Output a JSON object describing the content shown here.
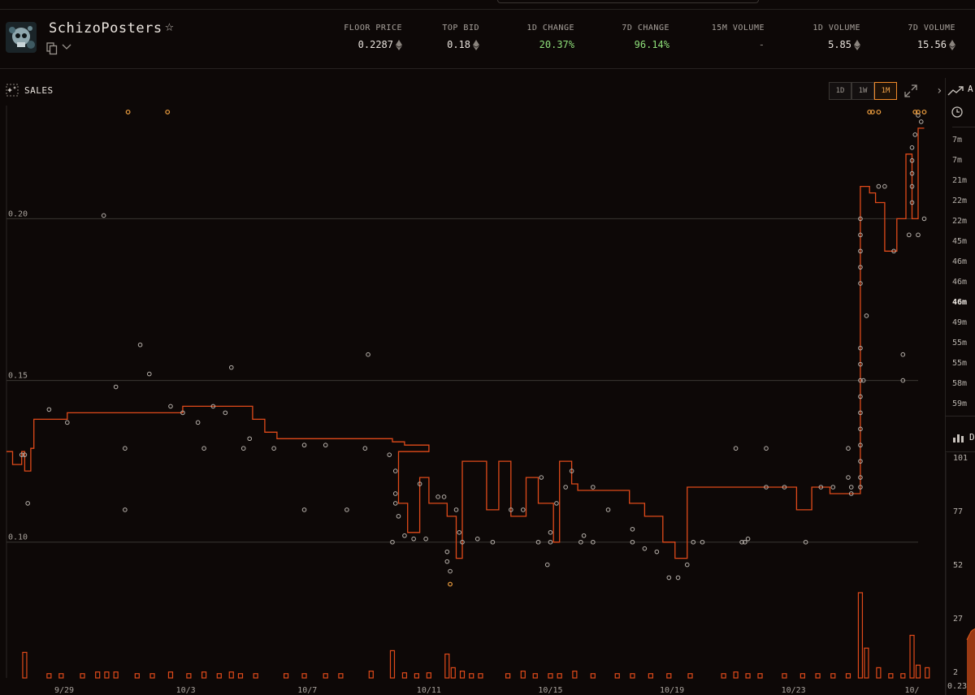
{
  "collection": {
    "name": "SchizoPosters",
    "icons": {
      "favorite": "star-outline-icon",
      "copy": "copy-icon",
      "menu": "chevron-down-icon"
    }
  },
  "stats": [
    {
      "label": "FLOOR PRICE",
      "value": "0.2287",
      "eth": true,
      "tone": "default"
    },
    {
      "label": "TOP BID",
      "value": "0.18",
      "eth": true,
      "tone": "default"
    },
    {
      "label": "1D CHANGE",
      "value": "20.37%",
      "eth": false,
      "tone": "positive"
    },
    {
      "label": "7D CHANGE",
      "value": "96.14%",
      "eth": false,
      "tone": "positive"
    },
    {
      "label": "15M VOLUME",
      "value": "-",
      "eth": false,
      "tone": "muted"
    },
    {
      "label": "1D VOLUME",
      "value": "5.85",
      "eth": true,
      "tone": "default"
    },
    {
      "label": "7D VOLUME",
      "value": "15.56",
      "eth": true,
      "tone": "default"
    }
  ],
  "panel": {
    "title": "SALES",
    "ranges": [
      "1D",
      "1W",
      "1M"
    ],
    "active_range": "1M",
    "icons": {
      "sales": "sparkles-icon",
      "expand": "expand-icon",
      "collapse": "chevron-right-icon"
    }
  },
  "colors": {
    "background": "#0d0807",
    "accent": "#f08a2a",
    "floor_line": "#e04a1a",
    "sale_dot": "#b8b2ac",
    "sale_dot_high": "#f0a040",
    "volume_bar": "#e04a1a",
    "positive": "#8fe07a"
  },
  "chart_data": {
    "type": "scatter",
    "title": "SALES",
    "xlabel": "",
    "ylabel": "",
    "x_ticks": [
      "9/29",
      "10/3",
      "10/7",
      "10/11",
      "10/15",
      "10/19",
      "10/23",
      "10/"
    ],
    "y_ticks": [
      "0.10",
      "0.15",
      "0.20"
    ],
    "ylim": [
      0.058,
      0.234
    ],
    "x_domain": [
      0,
      30
    ],
    "grid": true,
    "floor_series": {
      "name": "",
      "points": [
        [
          0,
          0.128
        ],
        [
          0.2,
          0.128
        ],
        [
          0.2,
          0.124
        ],
        [
          0.5,
          0.124
        ],
        [
          0.5,
          0.128
        ],
        [
          0.6,
          0.128
        ],
        [
          0.6,
          0.122
        ],
        [
          0.8,
          0.122
        ],
        [
          0.8,
          0.129
        ],
        [
          0.9,
          0.129
        ],
        [
          0.9,
          0.138
        ],
        [
          2.0,
          0.138
        ],
        [
          2.0,
          0.14
        ],
        [
          5.8,
          0.14
        ],
        [
          5.8,
          0.142
        ],
        [
          8.1,
          0.142
        ],
        [
          8.1,
          0.138
        ],
        [
          8.5,
          0.138
        ],
        [
          8.5,
          0.134
        ],
        [
          8.9,
          0.134
        ],
        [
          8.9,
          0.132
        ],
        [
          12.7,
          0.132
        ],
        [
          12.7,
          0.131
        ],
        [
          13.1,
          0.131
        ],
        [
          13.1,
          0.13
        ],
        [
          13.9,
          0.13
        ],
        [
          13.9,
          0.128
        ],
        [
          12.9,
          0.128
        ],
        [
          12.9,
          0.112
        ],
        [
          13.2,
          0.112
        ],
        [
          13.2,
          0.103
        ],
        [
          13.6,
          0.103
        ],
        [
          13.6,
          0.12
        ],
        [
          13.9,
          0.12
        ],
        [
          13.9,
          0.112
        ],
        [
          14.5,
          0.112
        ],
        [
          14.5,
          0.108
        ],
        [
          14.8,
          0.108
        ],
        [
          14.8,
          0.095
        ],
        [
          15.0,
          0.095
        ],
        [
          15.0,
          0.125
        ],
        [
          15.8,
          0.125
        ],
        [
          15.8,
          0.11
        ],
        [
          16.2,
          0.11
        ],
        [
          16.2,
          0.125
        ],
        [
          16.6,
          0.125
        ],
        [
          16.6,
          0.108
        ],
        [
          17.1,
          0.108
        ],
        [
          17.1,
          0.12
        ],
        [
          17.5,
          0.12
        ],
        [
          17.5,
          0.112
        ],
        [
          18.0,
          0.112
        ],
        [
          18.0,
          0.1
        ],
        [
          18.2,
          0.1
        ],
        [
          18.2,
          0.125
        ],
        [
          18.6,
          0.125
        ],
        [
          18.6,
          0.118
        ],
        [
          18.8,
          0.118
        ],
        [
          18.8,
          0.116
        ],
        [
          20.5,
          0.116
        ],
        [
          20.5,
          0.112
        ],
        [
          21.0,
          0.112
        ],
        [
          21.0,
          0.108
        ],
        [
          21.6,
          0.108
        ],
        [
          21.6,
          0.1
        ],
        [
          22.0,
          0.1
        ],
        [
          22.0,
          0.095
        ],
        [
          22.4,
          0.095
        ],
        [
          22.4,
          0.117
        ],
        [
          26.0,
          0.117
        ],
        [
          26.0,
          0.11
        ],
        [
          26.5,
          0.11
        ],
        [
          26.5,
          0.117
        ],
        [
          27.1,
          0.117
        ],
        [
          27.1,
          0.115
        ],
        [
          28.1,
          0.115
        ],
        [
          28.1,
          0.21
        ],
        [
          28.4,
          0.21
        ],
        [
          28.4,
          0.208
        ],
        [
          28.6,
          0.208
        ],
        [
          28.6,
          0.205
        ],
        [
          28.9,
          0.205
        ],
        [
          28.9,
          0.19
        ],
        [
          29.3,
          0.19
        ],
        [
          29.3,
          0.2
        ],
        [
          29.6,
          0.2
        ],
        [
          29.6,
          0.22
        ],
        [
          29.8,
          0.22
        ],
        [
          29.8,
          0.2
        ],
        [
          30.0,
          0.2
        ],
        [
          30.0,
          0.228
        ],
        [
          30.2,
          0.228
        ]
      ]
    },
    "sales": [
      [
        0.5,
        0.127
      ],
      [
        0.6,
        0.127
      ],
      [
        0.7,
        0.112
      ],
      [
        1.4,
        0.141
      ],
      [
        2.0,
        0.137
      ],
      [
        3.2,
        0.201
      ],
      [
        3.6,
        0.148
      ],
      [
        3.9,
        0.129
      ],
      [
        3.9,
        0.11
      ],
      [
        4.4,
        0.161
      ],
      [
        4.7,
        0.152
      ],
      [
        5.4,
        0.142
      ],
      [
        5.8,
        0.14
      ],
      [
        6.3,
        0.137
      ],
      [
        6.5,
        0.129
      ],
      [
        6.8,
        0.142
      ],
      [
        7.2,
        0.14
      ],
      [
        7.4,
        0.154
      ],
      [
        7.8,
        0.129
      ],
      [
        8.0,
        0.132
      ],
      [
        8.8,
        0.129
      ],
      [
        9.8,
        0.11
      ],
      [
        9.8,
        0.13
      ],
      [
        10.5,
        0.13
      ],
      [
        11.2,
        0.11
      ],
      [
        11.8,
        0.129
      ],
      [
        12.6,
        0.127
      ],
      [
        11.9,
        0.158
      ],
      [
        12.7,
        0.1
      ],
      [
        12.8,
        0.122
      ],
      [
        12.8,
        0.115
      ],
      [
        12.8,
        0.112
      ],
      [
        12.9,
        0.108
      ],
      [
        13.1,
        0.102
      ],
      [
        13.4,
        0.101
      ],
      [
        13.6,
        0.118
      ],
      [
        13.8,
        0.101
      ],
      [
        14.2,
        0.114
      ],
      [
        14.4,
        0.114
      ],
      [
        14.5,
        0.097
      ],
      [
        14.5,
        0.094
      ],
      [
        14.6,
        0.091
      ],
      [
        14.8,
        0.11
      ],
      [
        14.9,
        0.103
      ],
      [
        15.0,
        0.1
      ],
      [
        15.5,
        0.101
      ],
      [
        16.0,
        0.1
      ],
      [
        16.6,
        0.11
      ],
      [
        17.0,
        0.11
      ],
      [
        17.5,
        0.1
      ],
      [
        17.6,
        0.12
      ],
      [
        17.9,
        0.103
      ],
      [
        17.8,
        0.093
      ],
      [
        17.9,
        0.1
      ],
      [
        18.1,
        0.112
      ],
      [
        18.4,
        0.117
      ],
      [
        18.6,
        0.122
      ],
      [
        18.9,
        0.1
      ],
      [
        19.0,
        0.102
      ],
      [
        19.3,
        0.1
      ],
      [
        19.3,
        0.117
      ],
      [
        19.8,
        0.11
      ],
      [
        20.6,
        0.104
      ],
      [
        20.6,
        0.1
      ],
      [
        21.0,
        0.098
      ],
      [
        21.4,
        0.097
      ],
      [
        21.8,
        0.089
      ],
      [
        22.1,
        0.089
      ],
      [
        22.4,
        0.093
      ],
      [
        22.6,
        0.1
      ],
      [
        22.9,
        0.1
      ],
      [
        24.0,
        0.129
      ],
      [
        24.2,
        0.1
      ],
      [
        24.3,
        0.1
      ],
      [
        24.4,
        0.101
      ],
      [
        25.0,
        0.129
      ],
      [
        25.6,
        0.117
      ],
      [
        25.0,
        0.117
      ],
      [
        26.3,
        0.1
      ],
      [
        26.8,
        0.117
      ],
      [
        27.2,
        0.117
      ],
      [
        27.7,
        0.129
      ],
      [
        27.7,
        0.12
      ],
      [
        27.8,
        0.117
      ],
      [
        27.8,
        0.115
      ],
      [
        28.1,
        0.2
      ],
      [
        28.1,
        0.195
      ],
      [
        28.1,
        0.19
      ],
      [
        28.1,
        0.185
      ],
      [
        28.1,
        0.18
      ],
      [
        28.1,
        0.16
      ],
      [
        28.1,
        0.155
      ],
      [
        28.1,
        0.15
      ],
      [
        28.1,
        0.145
      ],
      [
        28.1,
        0.14
      ],
      [
        28.1,
        0.135
      ],
      [
        28.1,
        0.13
      ],
      [
        28.1,
        0.125
      ],
      [
        28.1,
        0.12
      ],
      [
        28.1,
        0.117
      ],
      [
        28.2,
        0.15
      ],
      [
        28.3,
        0.17
      ],
      [
        28.7,
        0.21
      ],
      [
        28.9,
        0.21
      ],
      [
        29.2,
        0.19
      ],
      [
        29.5,
        0.158
      ],
      [
        29.5,
        0.15
      ],
      [
        29.7,
        0.195
      ],
      [
        29.8,
        0.205
      ],
      [
        29.8,
        0.21
      ],
      [
        29.8,
        0.214
      ],
      [
        29.8,
        0.218
      ],
      [
        29.8,
        0.222
      ],
      [
        29.9,
        0.226
      ],
      [
        30.0,
        0.232
      ],
      [
        30.1,
        0.23
      ],
      [
        30.0,
        0.195
      ],
      [
        30.2,
        0.2
      ]
    ],
    "high_sales": [
      [
        4.0,
        0.233
      ],
      [
        5.3,
        0.233
      ],
      [
        28.4,
        0.233
      ],
      [
        28.5,
        0.233
      ],
      [
        28.7,
        0.233
      ],
      [
        29.9,
        0.233
      ],
      [
        30.0,
        0.233
      ],
      [
        30.2,
        0.233
      ],
      [
        14.6,
        0.087
      ]
    ],
    "volume": [
      [
        0.6,
        0.3
      ],
      [
        1.4,
        0.05
      ],
      [
        1.8,
        0.05
      ],
      [
        2.5,
        0.05
      ],
      [
        3.0,
        0.07
      ],
      [
        3.3,
        0.07
      ],
      [
        3.6,
        0.07
      ],
      [
        4.3,
        0.05
      ],
      [
        4.8,
        0.05
      ],
      [
        5.4,
        0.07
      ],
      [
        6.0,
        0.05
      ],
      [
        6.5,
        0.07
      ],
      [
        7.0,
        0.05
      ],
      [
        7.4,
        0.07
      ],
      [
        7.7,
        0.05
      ],
      [
        8.2,
        0.05
      ],
      [
        9.2,
        0.05
      ],
      [
        9.8,
        0.05
      ],
      [
        10.5,
        0.05
      ],
      [
        11.0,
        0.05
      ],
      [
        12.0,
        0.08
      ],
      [
        12.7,
        0.32
      ],
      [
        13.1,
        0.06
      ],
      [
        13.5,
        0.05
      ],
      [
        13.9,
        0.06
      ],
      [
        14.5,
        0.28
      ],
      [
        14.7,
        0.12
      ],
      [
        15.0,
        0.08
      ],
      [
        15.3,
        0.05
      ],
      [
        15.6,
        0.05
      ],
      [
        16.5,
        0.05
      ],
      [
        17.0,
        0.08
      ],
      [
        17.4,
        0.05
      ],
      [
        17.9,
        0.05
      ],
      [
        18.2,
        0.05
      ],
      [
        18.7,
        0.08
      ],
      [
        19.3,
        0.05
      ],
      [
        20.1,
        0.05
      ],
      [
        20.6,
        0.05
      ],
      [
        21.2,
        0.05
      ],
      [
        21.8,
        0.05
      ],
      [
        22.5,
        0.05
      ],
      [
        23.6,
        0.05
      ],
      [
        24.0,
        0.07
      ],
      [
        24.4,
        0.05
      ],
      [
        24.8,
        0.05
      ],
      [
        25.6,
        0.05
      ],
      [
        26.2,
        0.05
      ],
      [
        26.7,
        0.05
      ],
      [
        27.2,
        0.05
      ],
      [
        27.7,
        0.05
      ],
      [
        28.1,
        1.0
      ],
      [
        28.3,
        0.35
      ],
      [
        28.7,
        0.12
      ],
      [
        29.1,
        0.05
      ],
      [
        29.5,
        0.05
      ],
      [
        29.8,
        0.5
      ],
      [
        30.0,
        0.15
      ],
      [
        30.3,
        0.12
      ]
    ]
  },
  "side": {
    "panel_letter": "A",
    "times": [
      "7m",
      "7m",
      "21m",
      "22m",
      "22m",
      "45m",
      "46m",
      "46m",
      "46m",
      "49m",
      "55m",
      "55m",
      "58m",
      "59m"
    ],
    "highlight_index": 8,
    "section_letter": "D",
    "values": [
      "101",
      "77",
      "52",
      "27",
      "2"
    ],
    "footer_value": "0.23",
    "icons": {
      "trend": "trend-icon",
      "clock": "clock-icon",
      "bars": "bar-chart-icon"
    }
  }
}
